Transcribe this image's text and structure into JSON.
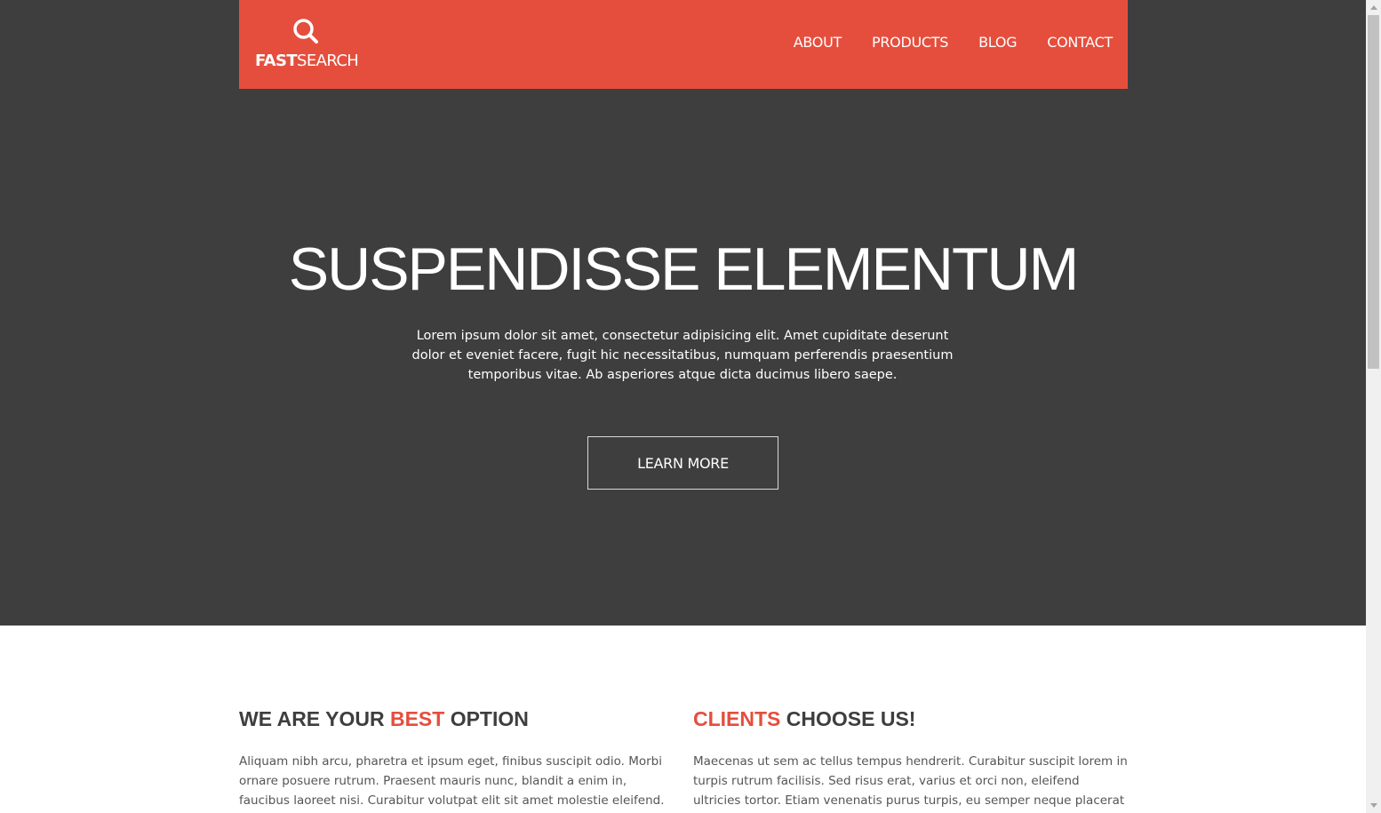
{
  "header": {
    "logo_bold": "FAST",
    "logo_light": "SEARCH",
    "logo_icon": "search-icon",
    "nav": [
      "ABOUT",
      "PRODUCTS",
      "BLOG",
      "CONTACT"
    ]
  },
  "hero": {
    "title": "SUSPENDISSE ELEMENTUM",
    "text": "Lorem ipsum dolor sit amet, consectetur adipisicing elit. Amet cupiditate deserunt dolor et eveniet facere, fugit hic necessitatibus, numquam perferendis praesentium temporibus vitae. Ab asperiores atque dicta ducimus libero saepe.",
    "button": "LEARN MORE"
  },
  "features": {
    "left": {
      "title_pre": "WE ARE YOUR ",
      "title_accent": "BEST",
      "title_post": " OPTION",
      "text": "Aliquam nibh arcu, pharetra et ipsum eget, finibus suscipit odio. Morbi ornare posuere rutrum. Praesent mauris nunc, blandit a enim in, faucibus laoreet nisi. Curabitur volutpat elit sit amet molestie eleifend. Sed rutrum"
    },
    "right": {
      "title_accent": "CLIENTS",
      "title_post": " CHOOSE US!",
      "text": "Maecenas ut sem ac tellus tempus hendrerit. Curabitur suscipit lorem in turpis rutrum facilisis. Sed risus erat, varius et orci non, eleifend ultricies tortor. Etiam venenatis purus turpis, eu semper neque placerat ut."
    }
  },
  "colors": {
    "accent": "#e54e3d",
    "hero_bg": "#3e3e3f",
    "heading": "#3e3e3f"
  }
}
